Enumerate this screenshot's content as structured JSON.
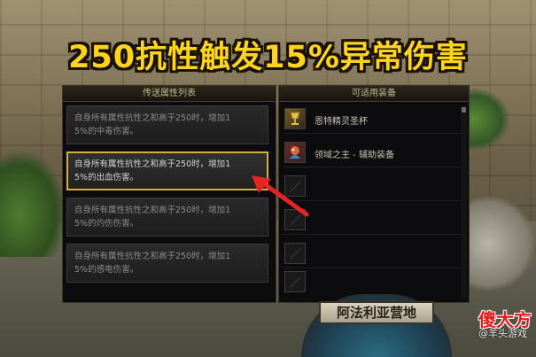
{
  "headline": "250抗性触发15%异常伤害",
  "left_panel": {
    "title": "传送属性列表",
    "items": [
      {
        "line1": "自身所有属性抗性之和高于250时，增加1",
        "line2": "5%的中毒伤害。"
      },
      {
        "line1": "自身所有属性抗性之和高于250时，增加1",
        "line2": "5%的出血伤害。"
      },
      {
        "line1": "自身所有属性抗性之和高于250时，增加1",
        "line2": "5%的灼伤伤害。"
      },
      {
        "line1": "自身所有属性抗性之和高于250时，增加1",
        "line2": "5%的感电伤害。"
      }
    ]
  },
  "right_panel": {
    "title": "可适用装备",
    "items": [
      {
        "name": "恩特精灵圣杯",
        "icon": "chalice-icon"
      },
      {
        "name": "领域之主 - 辅助装备",
        "icon": "domain-lord-icon"
      }
    ]
  },
  "town": {
    "name": "阿法利亚营地"
  },
  "watermark": {
    "logo": "傻大方",
    "text": "@羊头游戏"
  },
  "colors": {
    "headline": "#ffd41f",
    "selected_border": "#d6b13a",
    "arrow": "#e62424"
  }
}
